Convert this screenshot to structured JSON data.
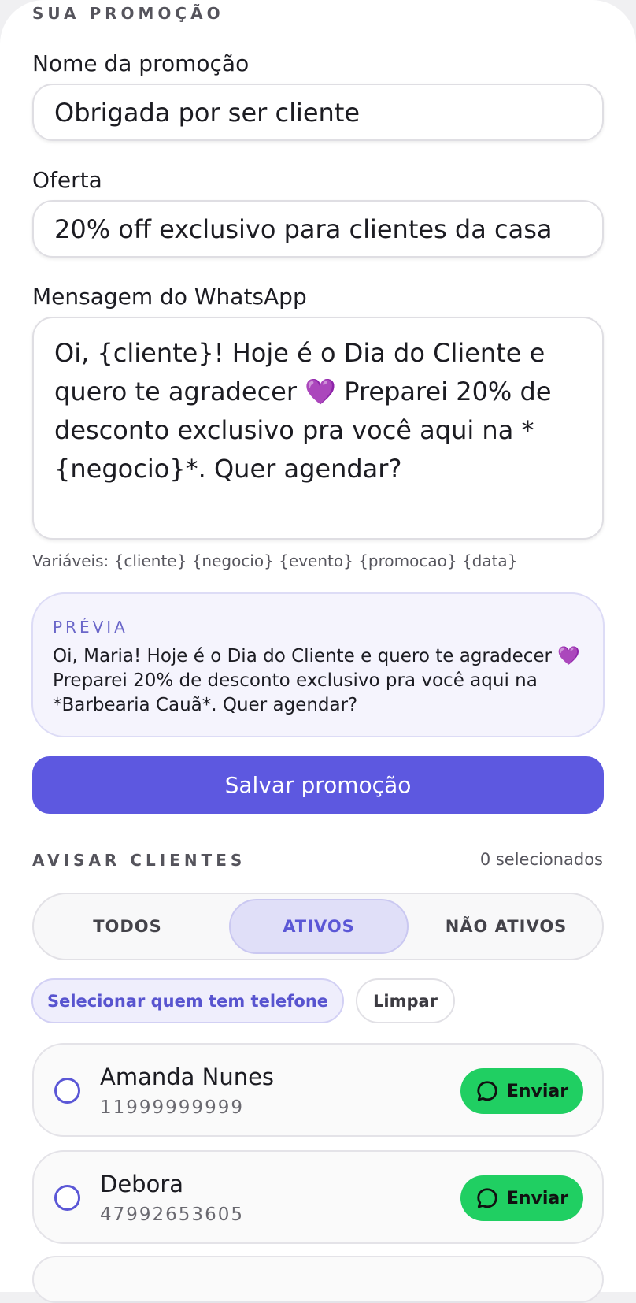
{
  "section": {
    "title": "SUA PROMOÇÃO"
  },
  "form": {
    "name_label": "Nome da promoção",
    "name_value": "Obrigada por ser cliente",
    "offer_label": "Oferta",
    "offer_value": "20% off exclusivo para clientes da casa",
    "message_label": "Mensagem do WhatsApp",
    "message_value": "Oi, {cliente}! Hoje é o Dia do Cliente e quero te agradecer 💜 Preparei 20% de desconto exclusivo pra você aqui na *{negocio}*. Quer agendar?",
    "variables_hint": "Variáveis: {cliente} {negocio} {evento} {promocao} {data}"
  },
  "preview": {
    "title": "PRÉVIA",
    "text": "Oi, Maria! Hoje é o Dia do Cliente e quero te agradecer 💜 Preparei 20% de desconto exclusivo pra você aqui na *Barbearia Cauã*. Quer agendar?"
  },
  "save_button": "Salvar promoção",
  "notify": {
    "title": "AVISAR CLIENTES",
    "selected_count": "0 selecionados",
    "filters": [
      "TODOS",
      "ATIVOS",
      "NÃO ATIVOS"
    ],
    "active_filter": "ATIVOS",
    "select_with_phone": "Selecionar quem tem telefone",
    "clear": "Limpar",
    "send_label": "Enviar"
  },
  "clients": [
    {
      "name": "Amanda Nunes",
      "phone": "11999999999",
      "selected": false
    },
    {
      "name": "Debora",
      "phone": "47992653605",
      "selected": false
    }
  ],
  "colors": {
    "accent": "#5d58e0",
    "whatsapp_green": "#20cf62"
  }
}
